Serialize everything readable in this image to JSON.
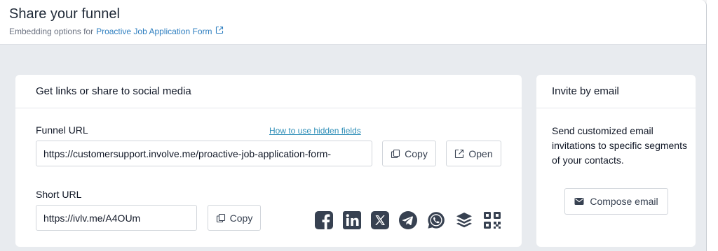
{
  "header": {
    "title": "Share your funnel",
    "subtitle_prefix": "Embedding options for",
    "funnel_name": "Proactive Job Application Form"
  },
  "share_card": {
    "heading": "Get links or share to social media",
    "funnel_url_label": "Funnel URL",
    "hidden_fields_link": "How to use hidden fields",
    "funnel_url_value": "https://customersupport.involve.me/proactive-job-application-form-",
    "copy_label": "Copy",
    "open_label": "Open",
    "short_url_label": "Short URL",
    "short_url_value": "https://ivlv.me/A4OUm",
    "short_copy_label": "Copy",
    "social_icons": [
      "facebook-icon",
      "linkedin-icon",
      "x-icon",
      "telegram-icon",
      "whatsapp-icon",
      "buffer-icon",
      "qr-code-icon"
    ]
  },
  "invite_card": {
    "heading": "Invite by email",
    "description": "Send customized email invitations to specific segments of your contacts.",
    "compose_label": "Compose email"
  },
  "colors": {
    "link": "#2f7fc0",
    "icon": "#374151",
    "background": "#e8ebef"
  }
}
